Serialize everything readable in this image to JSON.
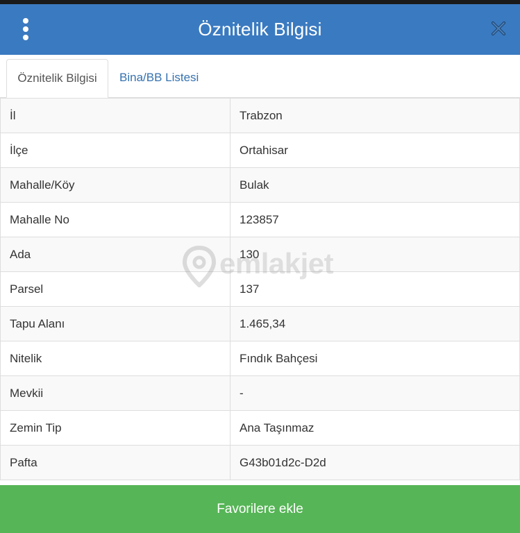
{
  "header": {
    "title": "Öznitelik Bilgisi",
    "menu_icon": "more-vertical-icon",
    "close_icon": "close-icon",
    "color": "#3a7ac0"
  },
  "tabs": [
    {
      "label": "Öznitelik Bilgisi",
      "active": true
    },
    {
      "label": "Bina/BB Listesi",
      "active": false
    }
  ],
  "attributes": [
    {
      "key": "İl",
      "value": "Trabzon"
    },
    {
      "key": "İlçe",
      "value": "Ortahisar"
    },
    {
      "key": "Mahalle/Köy",
      "value": "Bulak"
    },
    {
      "key": "Mahalle No",
      "value": "123857"
    },
    {
      "key": "Ada",
      "value": "130"
    },
    {
      "key": "Parsel",
      "value": "137"
    },
    {
      "key": "Tapu Alanı",
      "value": "1.465,34"
    },
    {
      "key": "Nitelik",
      "value": "Fındık Bahçesi"
    },
    {
      "key": "Mevkii",
      "value": "-"
    },
    {
      "key": "Zemin Tip",
      "value": "Ana Taşınmaz"
    },
    {
      "key": "Pafta",
      "value": "G43b01d2c-D2d"
    }
  ],
  "watermark": {
    "text": "emlakjet",
    "icon": "location-pin-icon"
  },
  "footer": {
    "button_label": "Favorilere ekle",
    "color": "#56b556"
  }
}
